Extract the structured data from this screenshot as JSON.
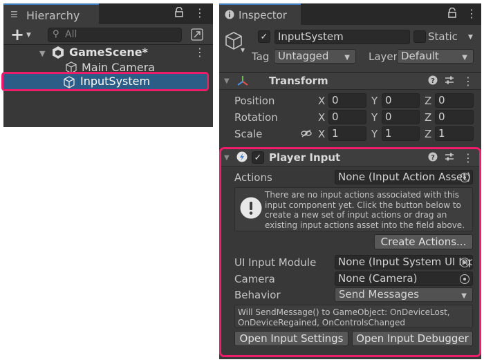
{
  "hierarchy": {
    "tab_label": "Hierarchy",
    "search_placeholder": "All",
    "scene_name": "GameScene*",
    "objects": [
      "Main Camera",
      "InputSystem"
    ]
  },
  "inspector": {
    "tab_label": "Inspector",
    "object_name": "InputSystem",
    "active_check": "✓",
    "static_label": "Static",
    "tag_label": "Tag",
    "tag_value": "Untagged",
    "layer_label": "Layer",
    "layer_value": "Default",
    "transform": {
      "title": "Transform",
      "rows": [
        {
          "label": "Position",
          "x": "0",
          "y": "0",
          "z": "0"
        },
        {
          "label": "Rotation",
          "x": "0",
          "y": "0",
          "z": "0"
        },
        {
          "label": "Scale",
          "x": "1",
          "y": "1",
          "z": "1"
        }
      ],
      "axes": [
        "X",
        "Y",
        "Z"
      ]
    },
    "player_input": {
      "title": "Player Input",
      "actions_label": "Actions",
      "actions_value": "None (Input Action Asset)",
      "help_lines": [
        "There are no input actions associated with this",
        "input component yet. Click the button below to",
        "create a new set of input actions or drag an",
        "existing input actions asset into the field above."
      ],
      "create_actions_button": "Create Actions...",
      "ui_module_label": "UI Input Module",
      "ui_module_value": "None (Input System UI Inp",
      "camera_label": "Camera",
      "camera_value": "None (Camera)",
      "behavior_label": "Behavior",
      "behavior_value": "Send Messages",
      "message_lines": [
        "Will SendMessage() to GameObject: OnDeviceLost,",
        "OnDeviceRegained, OnControlsChanged"
      ],
      "open_settings_button": "Open Input Settings",
      "open_debugger_button": "Open Input Debugger"
    }
  },
  "colors": {
    "highlight": "#ec1e69",
    "selection": "#2c5d87",
    "panel": "#383838",
    "tab_accent": "#3a79bb"
  }
}
